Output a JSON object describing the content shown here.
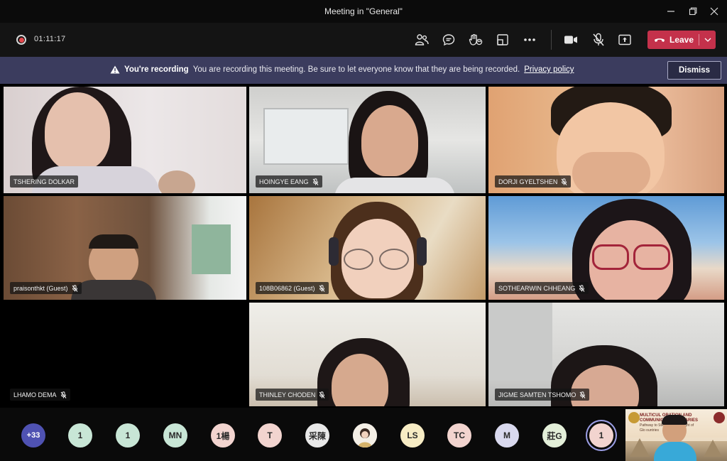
{
  "window": {
    "title": "Meeting in \"General\""
  },
  "toolbar": {
    "timer": "01:11:17",
    "leave_label": "Leave"
  },
  "banner": {
    "heading": "You're recording",
    "message": "You are recording this meeting. Be sure to let everyone know that they are being recorded.",
    "link": "Privacy policy",
    "dismiss_label": "Dismiss"
  },
  "participants": [
    {
      "name": "TSHERING DOLKAR",
      "muted": false
    },
    {
      "name": "HOINGYE EANG",
      "muted": true
    },
    {
      "name": "DORJI GYELTSHEN",
      "muted": true
    },
    {
      "name": "praisonthkt (Guest)",
      "muted": true
    },
    {
      "name": "108B06862 (Guest)",
      "muted": true
    },
    {
      "name": "SOTHEARWIN CHHEANG",
      "muted": true
    },
    {
      "name": "LHAMO DEMA",
      "muted": true
    },
    {
      "name": "THINLEY CHODEN",
      "muted": true
    },
    {
      "name": "JIGME SAMTEN TSHOMO",
      "muted": true
    }
  ],
  "roster": {
    "overflow": "+33",
    "avatars": [
      {
        "initials": "1",
        "color": "#c8e6d6"
      },
      {
        "initials": "1",
        "color": "#c8e6d6"
      },
      {
        "initials": "MN",
        "color": "#c8e6d6"
      },
      {
        "initials": "1楊",
        "color": "#f2d4cf"
      },
      {
        "initials": "T",
        "color": "#f2d4cf"
      },
      {
        "initials": "采陳",
        "color": "#e8e8e8"
      },
      {
        "initials": "",
        "color": "#f0f0f0"
      },
      {
        "initials": "LS",
        "color": "#f7ecc4"
      },
      {
        "initials": "TC",
        "color": "#f2d4cf"
      },
      {
        "initials": "M",
        "color": "#d9d9ee"
      },
      {
        "initials": "莊G",
        "color": "#e3efd9"
      },
      {
        "initials": "1",
        "color": "#f2d4cf"
      }
    ]
  },
  "selfview": {
    "slide_lines": [
      "MULTICUL  ORATION AND",
      "COMMUNIC  O BOUNDARIES",
      "Pathway to Stee   arrative Insight of",
      "Glo   ountries"
    ]
  },
  "colors": {
    "leave": "#c4314b",
    "banner": "#3b3c5e",
    "overflow_badge": "#4f52b2"
  }
}
